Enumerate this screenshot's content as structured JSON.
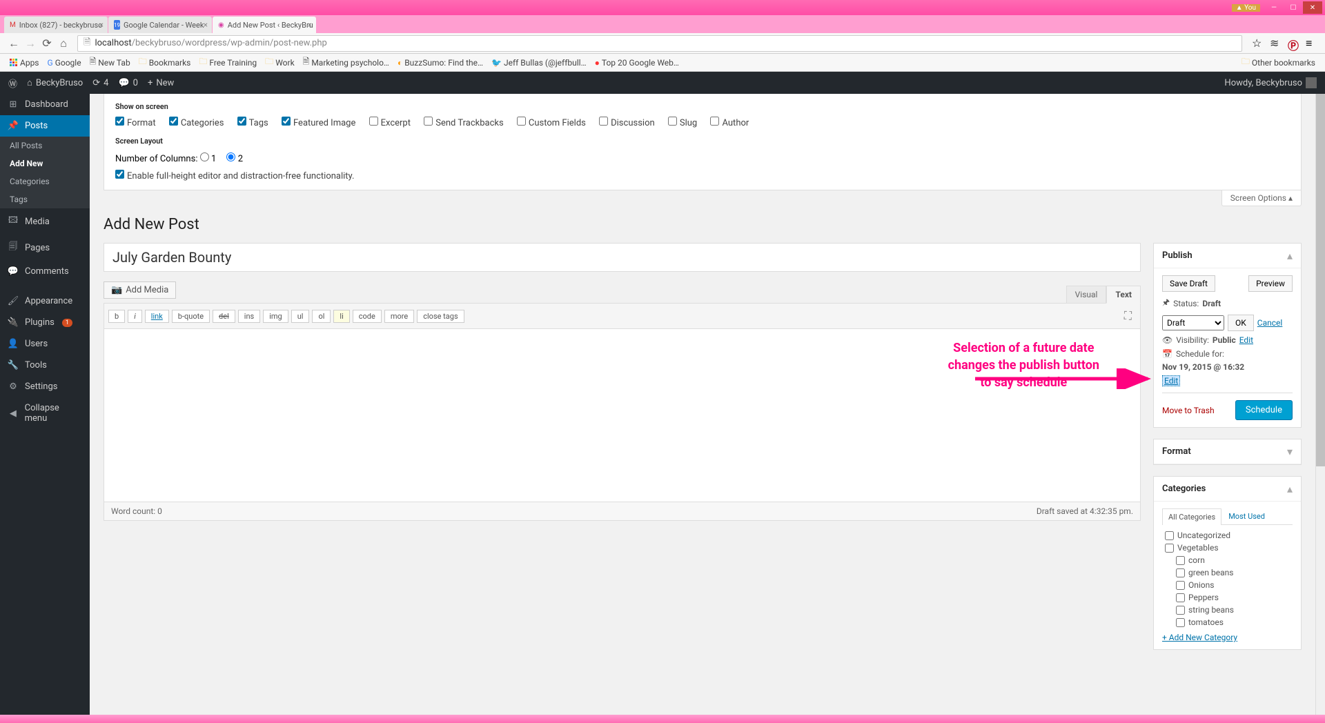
{
  "titlebar": {
    "you": "You"
  },
  "tabs": [
    {
      "label": "Inbox (827) - beckybruso",
      "favicon": "M"
    },
    {
      "label": "Google Calendar - Week",
      "favicon": "19"
    },
    {
      "label": "Add New Post ‹ BeckyBru",
      "favicon": "●",
      "active": true
    }
  ],
  "url": {
    "host": "localhost",
    "path": "/beckybruso/wordpress/wp-admin/post-new.php"
  },
  "bookmarks": {
    "apps": "Apps",
    "items": [
      "Google",
      "New Tab",
      "Bookmarks",
      "Free Training",
      "Work",
      "Marketing psycholo…",
      "BuzzSumo: Find the…",
      "Jeff Bullas (@jeffbull…",
      "Top 20 Google Web…"
    ],
    "other": "Other bookmarks"
  },
  "adminbar": {
    "site": "BeckyBruso",
    "comments": "4",
    "updates": "0",
    "new": "New",
    "howdy": "Howdy, Beckybruso"
  },
  "sidebar": {
    "dashboard": "Dashboard",
    "posts": "Posts",
    "posts_sub": {
      "all": "All Posts",
      "addnew": "Add New",
      "cats": "Categories",
      "tags": "Tags"
    },
    "media": "Media",
    "pages": "Pages",
    "comments": "Comments",
    "appearance": "Appearance",
    "plugins": "Plugins",
    "plugins_badge": "1",
    "users": "Users",
    "tools": "Tools",
    "settings": "Settings",
    "collapse": "Collapse menu"
  },
  "screenopts": {
    "show_label": "Show on screen",
    "boxes": {
      "format": "Format",
      "categories": "Categories",
      "tags": "Tags",
      "featured": "Featured Image",
      "excerpt": "Excerpt",
      "trackbacks": "Send Trackbacks",
      "custom": "Custom Fields",
      "discussion": "Discussion",
      "slug": "Slug",
      "author": "Author"
    },
    "layout_label": "Screen Layout",
    "cols_label": "Number of Columns:",
    "col1": "1",
    "col2": "2",
    "fullheight": "Enable full-height editor and distraction-free functionality.",
    "tab": "Screen Options"
  },
  "page": {
    "heading": "Add New Post",
    "title_value": "July Garden Bounty",
    "add_media": "Add Media",
    "tabs": {
      "visual": "Visual",
      "text": "Text"
    },
    "quicktags": [
      "b",
      "i",
      "link",
      "b-quote",
      "del",
      "ins",
      "img",
      "ul",
      "ol",
      "li",
      "code",
      "more",
      "close tags"
    ],
    "wordcount": "Word count: 0",
    "draftsaved": "Draft saved at 4:32:35 pm."
  },
  "publish": {
    "title": "Publish",
    "save_draft": "Save Draft",
    "preview": "Preview",
    "status_label": "Status:",
    "status_value": "Draft",
    "status_select": "Draft",
    "ok": "OK",
    "cancel": "Cancel",
    "visibility_label": "Visibility:",
    "visibility_value": "Public",
    "edit": "Edit",
    "schedule_label": "Schedule for:",
    "schedule_value": "Nov 19, 2015 @ 16:32",
    "trash": "Move to Trash",
    "button": "Schedule"
  },
  "format": {
    "title": "Format"
  },
  "categories": {
    "title": "Categories",
    "tab_all": "All Categories",
    "tab_used": "Most Used",
    "items": [
      {
        "name": "Uncategorized",
        "indent": false
      },
      {
        "name": "Vegetables",
        "indent": false
      },
      {
        "name": "corn",
        "indent": true
      },
      {
        "name": "green beans",
        "indent": true
      },
      {
        "name": "Onions",
        "indent": true
      },
      {
        "name": "Peppers",
        "indent": true
      },
      {
        "name": "string beans",
        "indent": true
      },
      {
        "name": "tomatoes",
        "indent": true
      }
    ],
    "add_new": "+ Add New Category"
  },
  "annotation": {
    "line1": "Selection of a future date",
    "line2": "changes the publish button",
    "line3": "to say schedule"
  }
}
